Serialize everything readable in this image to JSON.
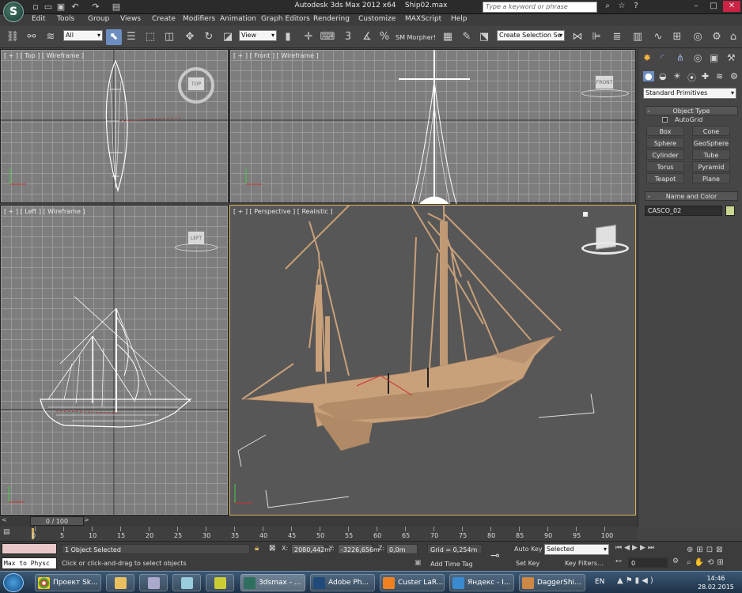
{
  "title": {
    "app": "Autodesk 3ds Max  2012 x64",
    "file": "Ship02.max"
  },
  "search_placeholder": "Type a keyword or phrase",
  "menu": [
    "Edit",
    "Tools",
    "Group",
    "Views",
    "Create",
    "Modifiers",
    "Animation",
    "Graph Editors",
    "Rendering",
    "Customize",
    "MAXScript",
    "Help"
  ],
  "toolbar": {
    "filter": "All",
    "ref_coord": "View",
    "morpher": "SM Morpher!",
    "selection_set": "Create Selection Se",
    "snap_angle": "3",
    "snap_percent": "%"
  },
  "viewports": {
    "top": "[ + ] [ Top ] [ Wireframe ]",
    "front": "[ + ] [ Front ] [ Wireframe ]",
    "left": "[ + ] [ Left ] [ Wireframe ]",
    "perspective": "[ + ] [ Perspective ] [ Realistic ]",
    "cube_top": "TOP",
    "cube_front": "FRONT",
    "cube_left": "LEFT"
  },
  "command_panel": {
    "category": "Standard Primitives",
    "object_type_header": "Object Type",
    "autogrid": "AutoGrid",
    "buttons": [
      "Box",
      "Cone",
      "Sphere",
      "GeoSphere",
      "Cylinder",
      "Tube",
      "Torus",
      "Pyramid",
      "Teapot",
      "Plane"
    ],
    "name_color_header": "Name and Color",
    "object_name": "CASCO_02",
    "object_color": "#c8d890"
  },
  "timeline": {
    "frame": "0 / 100",
    "ticks": [
      "0",
      "5",
      "10",
      "15",
      "20",
      "25",
      "30",
      "35",
      "40",
      "45",
      "50",
      "55",
      "60",
      "65",
      "70",
      "75",
      "80",
      "85",
      "90",
      "95",
      "100"
    ]
  },
  "status": {
    "maxscript": "Max to Physc",
    "selection": "1 Object Selected",
    "prompt": "Click or click-and-drag to select objects",
    "x": "2080,442m",
    "y": "-3226,656m",
    "z": "0,0m",
    "grid": "Grid = 0,254m",
    "add_time_tag": "Add Time Tag",
    "auto_key": "Auto Key",
    "set_key": "Set Key",
    "key_mode": "Selected",
    "key_filters": "Key Filters...",
    "current_frame": "0"
  },
  "taskbar": {
    "tasks": [
      "Проект Sk...",
      "",
      "",
      "",
      "",
      "3dsmax - ...",
      "Adobe Ph...",
      "Custer LaR...",
      "Яндекс - I...",
      "DaggerShi..."
    ],
    "lang": "EN",
    "time": "14:46",
    "date": "28.02.2015"
  },
  "colors": {
    "ship": "#c8a07a",
    "selection_box": "#dddddd",
    "active_border": "#d4b25c"
  }
}
